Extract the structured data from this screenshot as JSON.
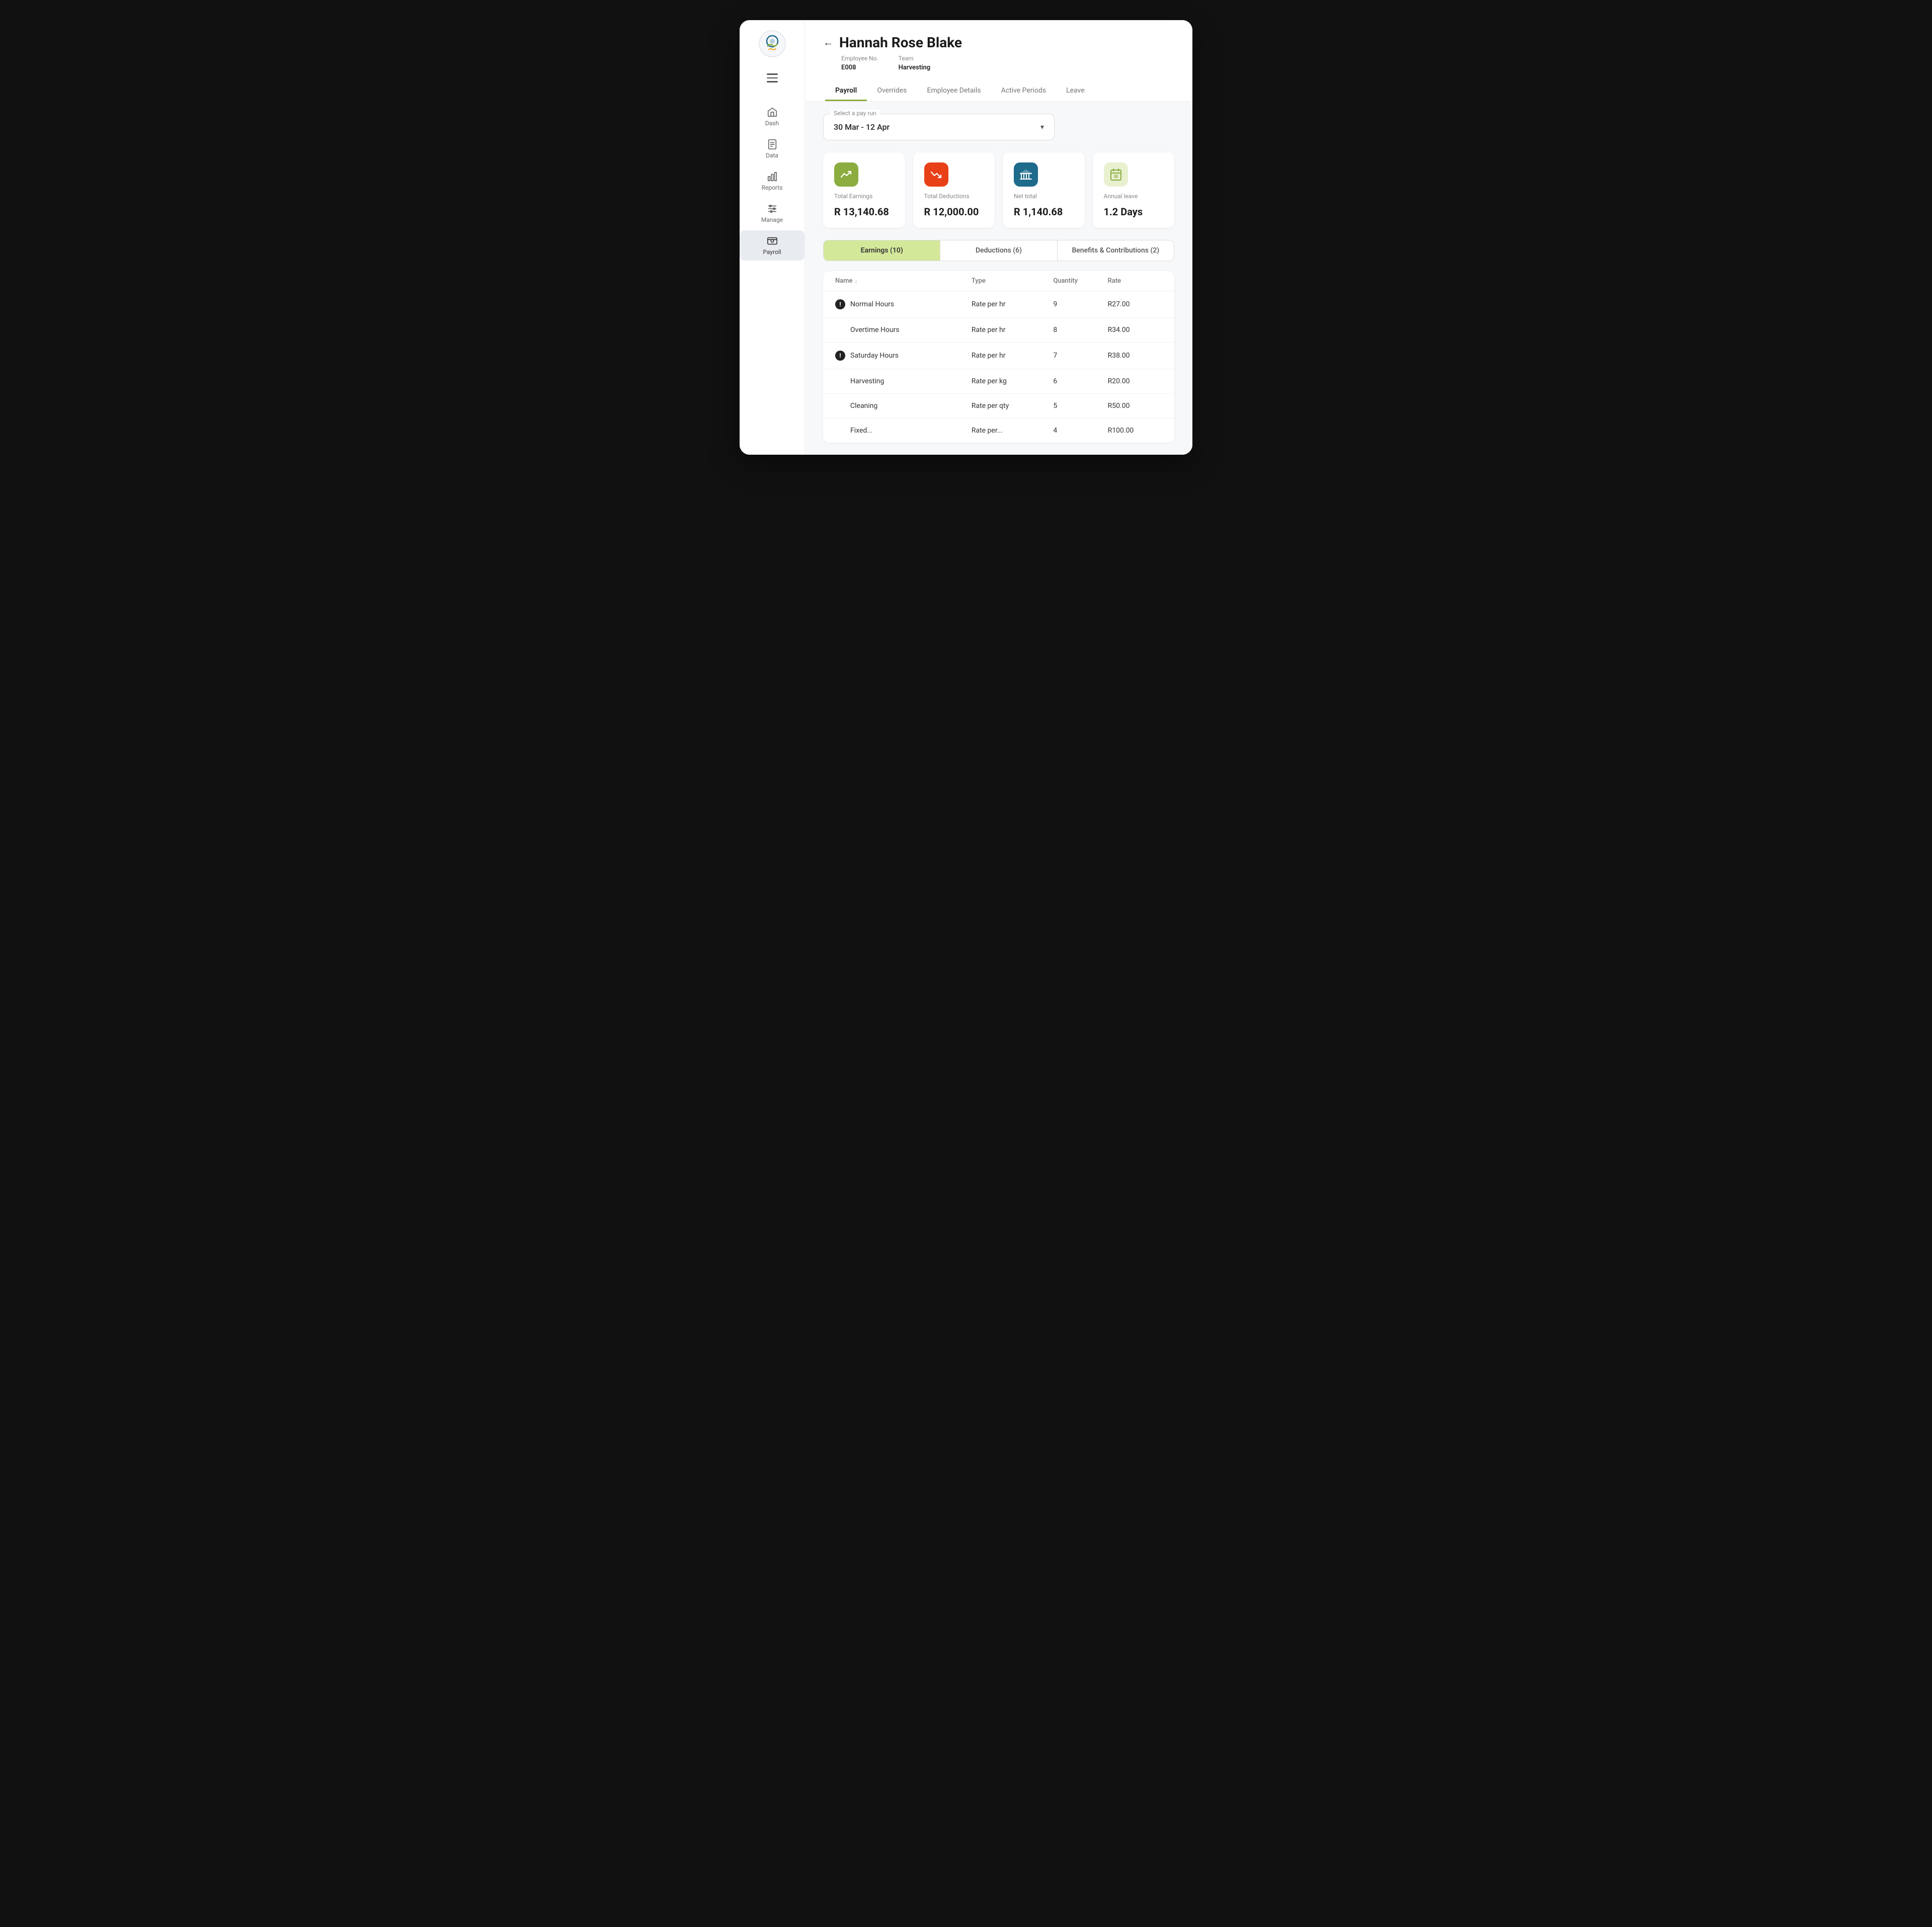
{
  "employee": {
    "name": "Hannah Rose Blake",
    "employee_no_label": "Employee No.",
    "employee_no": "E008",
    "team_label": "Team",
    "team": "Harvesting"
  },
  "nav": {
    "items": [
      {
        "id": "dash",
        "label": "Dash",
        "icon": "home"
      },
      {
        "id": "data",
        "label": "Data",
        "icon": "document"
      },
      {
        "id": "reports",
        "label": "Reports",
        "icon": "bar-chart"
      },
      {
        "id": "manage",
        "label": "Manage",
        "icon": "sliders"
      },
      {
        "id": "payroll",
        "label": "Payroll",
        "icon": "payroll"
      }
    ]
  },
  "tabs": [
    {
      "label": "Payroll",
      "active": true
    },
    {
      "label": "Overrides",
      "active": false
    },
    {
      "label": "Employee Details",
      "active": false
    },
    {
      "label": "Active Periods",
      "active": false
    },
    {
      "label": "Leave",
      "active": false
    }
  ],
  "pay_run": {
    "label": "Select a pay run",
    "value": "30 Mar - 12 Apr"
  },
  "summary_cards": [
    {
      "icon": "trending-up",
      "icon_style": "green",
      "label": "Total Earnings",
      "value": "R 13,140.68"
    },
    {
      "icon": "trending-down",
      "icon_style": "red",
      "label": "Total Deductions",
      "value": "R 12,000.00"
    },
    {
      "icon": "bank",
      "icon_style": "teal",
      "label": "Net total",
      "value": "R 1,140.68"
    },
    {
      "icon": "calendar",
      "icon_style": "light-green",
      "label": "Annual leave",
      "value": "1.2 Days"
    }
  ],
  "sub_tabs": [
    {
      "label": "Earnings (10)",
      "active": true
    },
    {
      "label": "Deductions (6)",
      "active": false
    },
    {
      "label": "Benefits & Contributions (2)",
      "active": false
    }
  ],
  "table": {
    "columns": [
      "Name",
      "Type",
      "Quantity",
      "Rate"
    ],
    "rows": [
      {
        "name": "Normal Hours",
        "type": "Rate per hr",
        "quantity": "9",
        "rate": "R27.00",
        "warning": true
      },
      {
        "name": "Overtime Hours",
        "type": "Rate per hr",
        "quantity": "8",
        "rate": "R34.00",
        "warning": false
      },
      {
        "name": "Saturday Hours",
        "type": "Rate per hr",
        "quantity": "7",
        "rate": "R38.00",
        "warning": true
      },
      {
        "name": "Harvesting",
        "type": "Rate per kg",
        "quantity": "6",
        "rate": "R20.00",
        "warning": false
      },
      {
        "name": "Cleaning",
        "type": "Rate per qty",
        "quantity": "5",
        "rate": "R50.00",
        "warning": false
      },
      {
        "name": "Fixed...",
        "type": "Rate per...",
        "quantity": "4",
        "rate": "R100.00",
        "warning": false
      }
    ]
  },
  "back_button_label": "←"
}
